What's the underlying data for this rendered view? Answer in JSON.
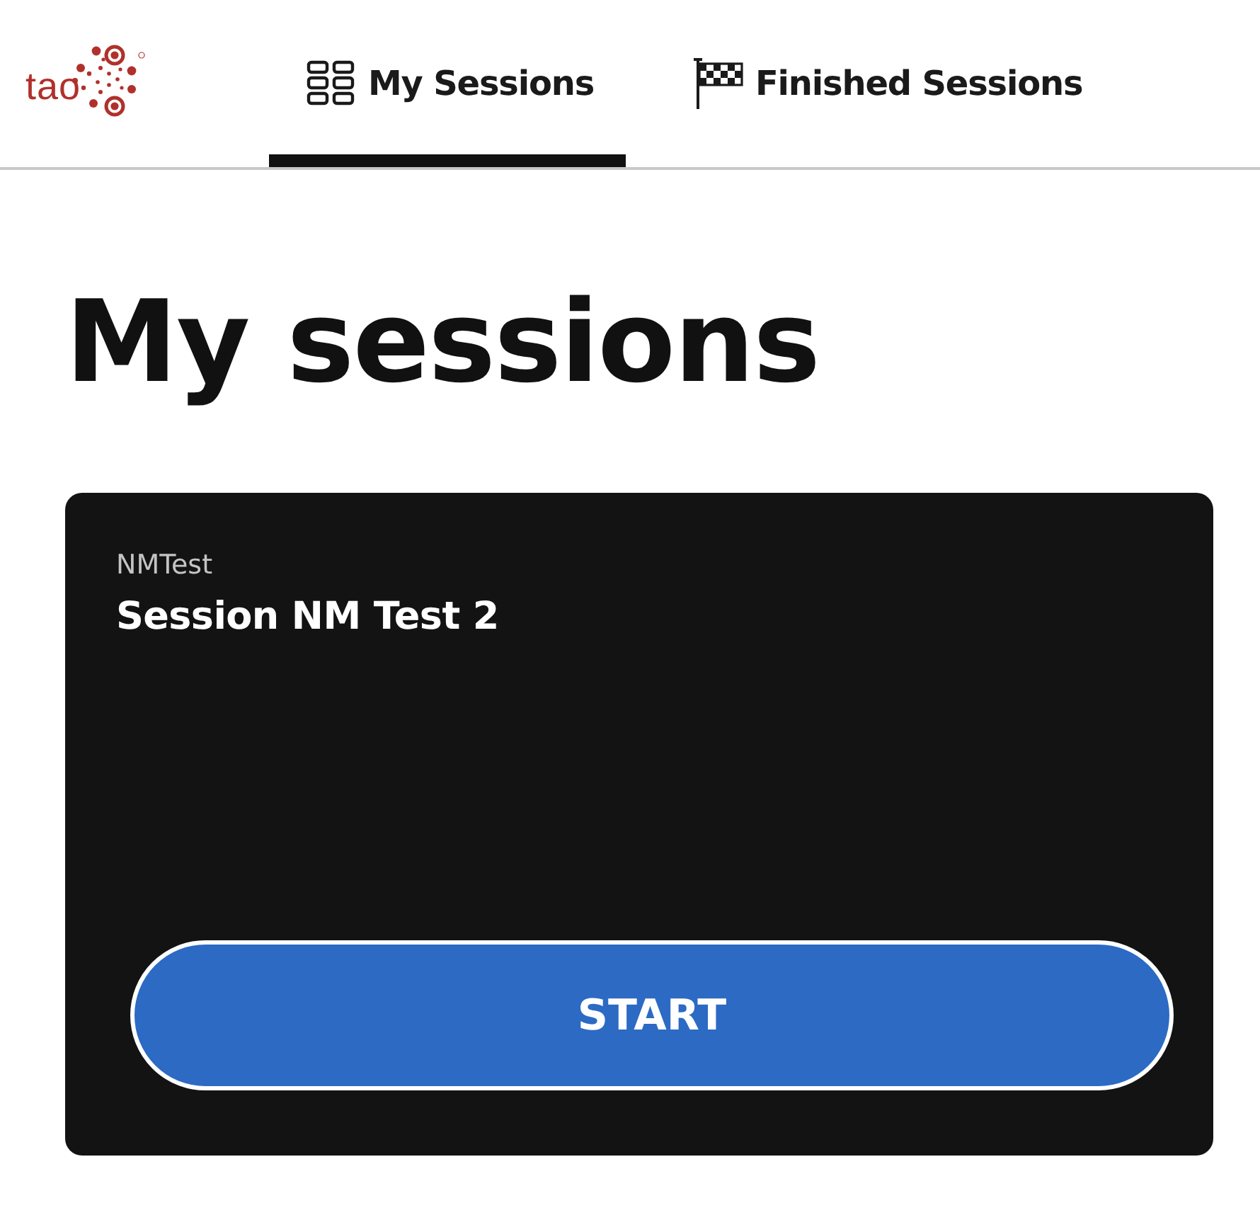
{
  "logo": {
    "text": "tao"
  },
  "tabs": [
    {
      "label": "My Sessions",
      "selected": true
    },
    {
      "label": "Finished Sessions",
      "selected": false
    }
  ],
  "heading": "My sessions",
  "sessions": [
    {
      "group": "NMTest",
      "title": "Session NM Test 2",
      "button": "START"
    }
  ]
}
